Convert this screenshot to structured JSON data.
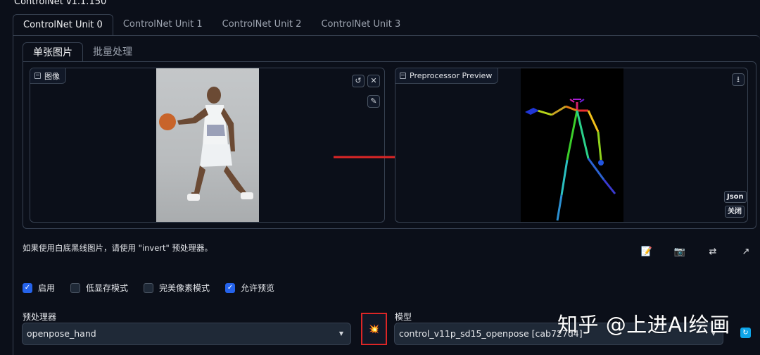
{
  "app": {
    "title": "ControlNet v1.1.150"
  },
  "unit_tabs": [
    {
      "label": "ControlNet Unit 0",
      "active": true
    },
    {
      "label": "ControlNet Unit 1",
      "active": false
    },
    {
      "label": "ControlNet Unit 2",
      "active": false
    },
    {
      "label": "ControlNet Unit 3",
      "active": false
    }
  ],
  "mode_tabs": [
    {
      "label": "单张图片",
      "active": true
    },
    {
      "label": "批量处理",
      "active": false
    }
  ],
  "image_input": {
    "label": "图像"
  },
  "preview": {
    "label": "Preprocessor Preview",
    "json_label": "Json",
    "close_label": "关闭"
  },
  "hint": "如果使用白底黑线图片，请使用 \"invert\" 预处理器。",
  "checkboxes": [
    {
      "label": "启用",
      "checked": true
    },
    {
      "label": "低显存模式",
      "checked": false
    },
    {
      "label": "完美像素模式",
      "checked": false
    },
    {
      "label": "允许预览",
      "checked": true
    }
  ],
  "preprocessor": {
    "label": "预处理器",
    "value": "openpose_hand"
  },
  "model": {
    "label": "模型",
    "value": "control_v11p_sd15_openpose [cab727d4]"
  },
  "watermark": "知乎 @上进AI绘画",
  "colors": {
    "accent": "#2563eb",
    "arrow": "#dc2626",
    "background": "#0b0f19"
  },
  "icons": [
    "undo-icon",
    "close-icon",
    "brush-icon",
    "download-icon",
    "notes-icon",
    "camera-icon",
    "swap-icon",
    "send-icon",
    "explosion-icon",
    "refresh-icon",
    "image-icon"
  ]
}
